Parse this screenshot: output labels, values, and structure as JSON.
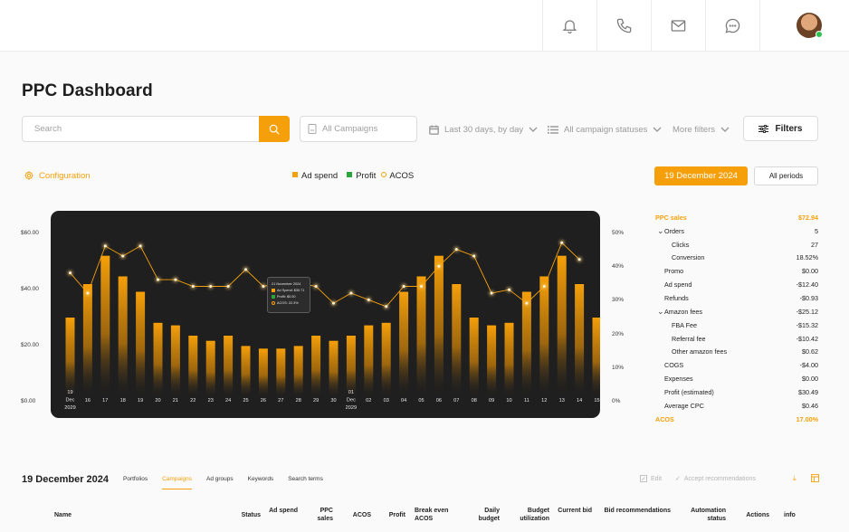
{
  "header": {
    "icons": [
      "bell-icon",
      "phone-icon",
      "mail-icon",
      "chat-icon"
    ],
    "avatar": "user-avatar"
  },
  "page": {
    "title": "PPC Dashboard"
  },
  "filters": {
    "search_placeholder": "Search",
    "campaigns_placeholder": "All Campaigns",
    "date_range": "Last 30 days, by day",
    "statuses": "All campaign statuses",
    "more_filters": "More filters",
    "filters_label": "Filters"
  },
  "toolbar": {
    "configuration": "Configuration",
    "legend": {
      "ad_spend": "Ad spend",
      "profit": "Profit",
      "acos": "ACOS"
    },
    "date_button": "19 December 2024",
    "all_periods": "All periods"
  },
  "chart_data": {
    "type": "bar",
    "colors": {
      "bars": "#f5a00a",
      "line": "#f5a00a",
      "profit": "#2aa53a",
      "background": "#1f1f1f"
    },
    "y_left_ticks": [
      "$60.00",
      "$40.00",
      "$20.00",
      "$0.00"
    ],
    "y_right_ticks": [
      "50%",
      "40%",
      "30%",
      "20%",
      "10%",
      "0%"
    ],
    "ylim": [
      0,
      60
    ],
    "ylim_right": [
      0,
      50
    ],
    "x_ticks": [
      [
        "19",
        "Dec",
        "2029"
      ],
      [
        "16"
      ],
      [
        "17"
      ],
      [
        "18"
      ],
      [
        "19"
      ],
      [
        "20"
      ],
      [
        "21"
      ],
      [
        "22"
      ],
      [
        "23"
      ],
      [
        "24"
      ],
      [
        "25"
      ],
      [
        "26"
      ],
      [
        "27"
      ],
      [
        "28"
      ],
      [
        "29"
      ],
      [
        "30"
      ],
      [
        "01",
        "Dec",
        "2029"
      ],
      [
        "02"
      ],
      [
        "03"
      ],
      [
        "04"
      ],
      [
        "05"
      ],
      [
        "06"
      ],
      [
        "07"
      ],
      [
        "08"
      ],
      [
        "09"
      ],
      [
        "10"
      ],
      [
        "11"
      ],
      [
        "12"
      ],
      [
        "13"
      ],
      [
        "14"
      ],
      [
        "15"
      ]
    ],
    "series": [
      {
        "name": "Ad spend",
        "values": [
          27,
          40,
          51,
          43,
          37,
          25,
          24,
          20,
          18,
          20,
          16,
          15,
          15,
          16,
          20,
          18,
          20,
          24,
          25,
          37,
          43,
          51,
          40,
          27,
          24,
          25,
          37,
          43,
          51,
          40,
          27
        ]
      },
      {
        "name": "ACOS",
        "values": [
          38,
          32,
          46,
          43,
          46,
          36,
          36,
          34,
          34,
          34,
          39,
          34,
          35,
          35,
          34,
          29,
          32,
          30,
          28,
          34,
          34,
          40,
          45,
          43,
          32,
          33,
          29,
          34,
          47,
          42
        ]
      }
    ],
    "tooltip": {
      "title": "21 November 2024",
      "ad_spend": "Ad Spend: $30.71",
      "profit": "Profit: $0.00",
      "acos": "ACOS: 22.3%"
    }
  },
  "summary": [
    {
      "label": "PPC sales",
      "value": "$72.94",
      "accent": true
    },
    {
      "label": "Orders",
      "value": "5",
      "chevron": true,
      "indent": 0
    },
    {
      "label": "Clicks",
      "value": "27",
      "indent": 2
    },
    {
      "label": "Conversion",
      "value": "18.52%",
      "indent": 2
    },
    {
      "label": "Promo",
      "value": "$0.00",
      "indent": 1
    },
    {
      "label": "Ad spend",
      "value": "-$12.40",
      "indent": 1
    },
    {
      "label": "Refunds",
      "value": "-$0.93",
      "indent": 1
    },
    {
      "label": "Amazon fees",
      "value": "-$25.12",
      "chevron": true,
      "indent": 0
    },
    {
      "label": "FBA Fee",
      "value": "-$15.32",
      "indent": 2
    },
    {
      "label": "Referral fee",
      "value": "-$10.42",
      "indent": 2
    },
    {
      "label": "Other amazon fees",
      "value": "$0.62",
      "indent": 2
    },
    {
      "label": "COGS",
      "value": "-$4.00",
      "indent": 1
    },
    {
      "label": "Expenses",
      "value": "$0.00",
      "indent": 1
    },
    {
      "label": "Profit (estimated)",
      "value": "$30.49",
      "indent": 1
    },
    {
      "label": "Average CPC",
      "value": "$0.46",
      "indent": 1
    },
    {
      "label": "ACOS",
      "value": "17.00%",
      "accent": true
    }
  ],
  "table": {
    "title": "19 December 2024",
    "tabs": [
      "Portfolios",
      "Campaigns",
      "Ad groups",
      "Keywords",
      "Search terms"
    ],
    "active_tab": 1,
    "edit": "Edit",
    "accept": "Accept recommendations",
    "columns": [
      "Name",
      "Status",
      "Ad spend",
      "PPC sales",
      "ACOS",
      "Profit",
      "Break even ACOS",
      "Daily budget",
      "Budget utilization",
      "Current bid",
      "Bid recommendations",
      "Automation status",
      "Actions",
      "info"
    ]
  }
}
